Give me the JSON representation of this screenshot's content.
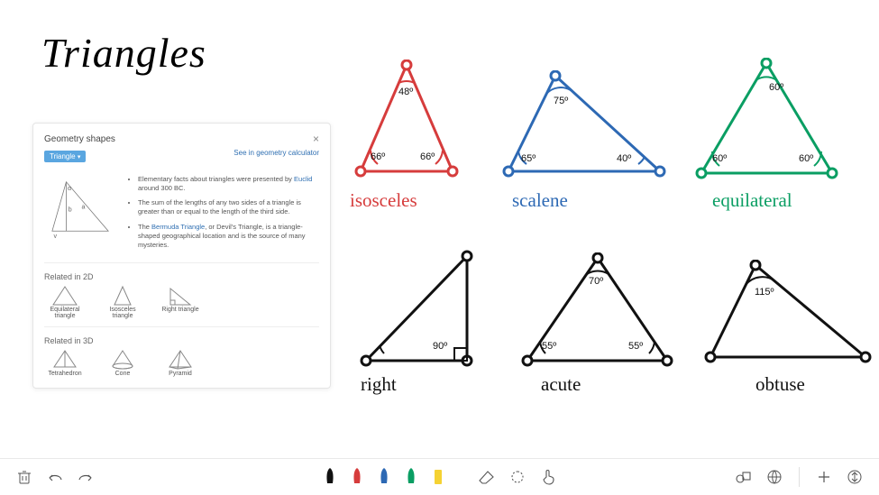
{
  "title": "Triangles",
  "info_card": {
    "title": "Geometry shapes",
    "dropdown_label": "Triangle",
    "link": "See in geometry calculator",
    "facts": [
      "Elementary facts about triangles were presented by <a href='#'>Euclid</a> around 300 BC.",
      "The sum of the lengths of any two sides of a triangle is greater than or equal to the length of the third side.",
      "The <a href='#'>Bermuda Triangle</a>, or Devil's Triangle, is a triangle-shaped geographical location and is the source of many mysteries."
    ],
    "related_2d_title": "Related in 2D",
    "related_2d": [
      "Equilateral triangle",
      "Isosceles triangle",
      "Right triangle"
    ],
    "related_3d_title": "Related in 3D",
    "related_3d": [
      "Tetrahedron",
      "Cone",
      "Pyramid"
    ],
    "mini_labels": {
      "a": "a",
      "b": "b",
      "alpha": "α",
      "gamma": "γ"
    }
  },
  "triangles": [
    {
      "id": "isosceles",
      "label": "isosceles",
      "label_color": "#d63c3c",
      "angles": [
        "48º",
        "66º",
        "66º"
      ]
    },
    {
      "id": "scalene",
      "label": "scalene",
      "label_color": "#2d69b4",
      "angles": [
        "75º",
        "65º",
        "40º"
      ]
    },
    {
      "id": "equilateral",
      "label": "equilateral",
      "label_color": "#0a9e63",
      "angles": [
        "60º",
        "60º",
        "60º"
      ]
    },
    {
      "id": "right",
      "label": "right",
      "label_color": "#111",
      "angles": [
        "90º"
      ]
    },
    {
      "id": "acute",
      "label": "acute",
      "label_color": "#111",
      "angles": [
        "70º",
        "55º",
        "55º"
      ]
    },
    {
      "id": "obtuse",
      "label": "obtuse",
      "label_color": "#111",
      "angles": [
        "115º"
      ]
    }
  ],
  "toolbar": {
    "pens": [
      "#111",
      "#d63c3c",
      "#2d69b4",
      "#0a9e63",
      "#f5d233"
    ]
  }
}
